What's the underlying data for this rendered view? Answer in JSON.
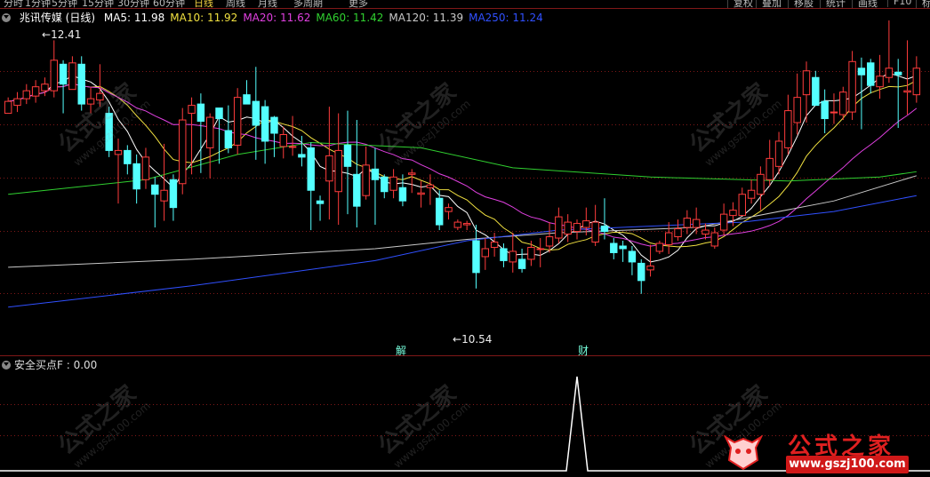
{
  "topbar": {
    "periods": [
      "分时",
      "1分钟",
      "5分钟",
      "15分钟",
      "30分钟",
      "60分钟",
      "日线",
      "周线",
      "月线",
      "多周期",
      "更多"
    ],
    "active_period": "日线",
    "right_buttons": [
      "复权",
      "叠加",
      "移股",
      "统计",
      "画线",
      "F10",
      "标"
    ]
  },
  "main_legend": {
    "stock": "兆讯传媒 (日线)",
    "ma": [
      {
        "label": "MA5: 11.98",
        "color": "#ffffff"
      },
      {
        "label": "MA10: 11.92",
        "color": "#f0e040"
      },
      {
        "label": "MA20: 11.62",
        "color": "#e040e0"
      },
      {
        "label": "MA60: 11.42",
        "color": "#30d030"
      },
      {
        "label": "MA120: 11.39",
        "color": "#c8c8c8"
      },
      {
        "label": "MA250: 11.24",
        "color": "#3050ff"
      }
    ]
  },
  "annotations": {
    "high_label": "12.41",
    "low_label": "10.54",
    "event1": "解",
    "event2": "财"
  },
  "indicator_legend": "安全买点F : 0.00",
  "watermark": {
    "text": "公式之家",
    "url": "www.gszj100.com"
  },
  "logo": {
    "text": "公式之家",
    "url": "www.gszj100.com"
  },
  "colors": {
    "up": "#ff3c3c",
    "down": "#54ffff",
    "grid": "#801818"
  },
  "chart_data": {
    "type": "candlestick",
    "ylim": [
      10.05,
      12.58
    ],
    "candles": [
      [
        11.86,
        11.95,
        11.98,
        11.88
      ],
      [
        11.92,
        11.97,
        12.02,
        11.87
      ],
      [
        11.97,
        12.03,
        12.08,
        11.93
      ],
      [
        11.99,
        12.06,
        12.11,
        11.94
      ],
      [
        12.03,
        12.08,
        12.13,
        11.99
      ],
      [
        12.03,
        12.26,
        12.41,
        11.98
      ],
      [
        12.23,
        12.08,
        12.26,
        11.86
      ],
      [
        12.04,
        12.24,
        12.29,
        12.08
      ],
      [
        12.23,
        11.93,
        12.29,
        11.88
      ],
      [
        11.93,
        11.97,
        12.06,
        11.86
      ],
      [
        11.96,
        12.01,
        12.23,
        11.91
      ],
      [
        11.86,
        11.58,
        11.91,
        11.53
      ],
      [
        11.55,
        11.58,
        11.67,
        11.18
      ],
      [
        11.58,
        11.48,
        11.62,
        11.4
      ],
      [
        11.48,
        11.29,
        11.55,
        11.18
      ],
      [
        11.36,
        11.53,
        11.6,
        11.29
      ],
      [
        11.32,
        11.25,
        11.38,
        11.0
      ],
      [
        11.2,
        11.28,
        11.63,
        11.05
      ],
      [
        11.36,
        11.15,
        11.4,
        11.05
      ],
      [
        11.33,
        11.81,
        11.9,
        11.25
      ],
      [
        11.86,
        11.92,
        11.98,
        11.4
      ],
      [
        11.93,
        11.8,
        12.01,
        11.41
      ],
      [
        11.6,
        11.83,
        11.86,
        11.37
      ],
      [
        11.9,
        11.82,
        11.86,
        11.48
      ],
      [
        11.73,
        11.6,
        11.92,
        11.56
      ],
      [
        11.62,
        11.98,
        12.05,
        11.55
      ],
      [
        12.0,
        11.93,
        12.11,
        11.95
      ],
      [
        11.95,
        11.77,
        12.21,
        11.51
      ],
      [
        11.91,
        11.65,
        11.96,
        11.48
      ],
      [
        11.83,
        11.71,
        11.84,
        11.53
      ],
      [
        11.61,
        11.7,
        11.76,
        11.52
      ],
      [
        11.61,
        11.61,
        11.84,
        11.54
      ],
      [
        11.55,
        11.53,
        11.69,
        11.46
      ],
      [
        11.6,
        11.28,
        11.64,
        10.98
      ],
      [
        11.2,
        11.18,
        11.24,
        11.05
      ],
      [
        11.35,
        11.54,
        11.91,
        11.06
      ],
      [
        11.27,
        11.58,
        11.86,
        11.02
      ],
      [
        11.62,
        11.46,
        11.88,
        11.1
      ],
      [
        11.4,
        11.16,
        11.81,
        11.0
      ],
      [
        11.24,
        11.47,
        11.61,
        11.21
      ],
      [
        11.44,
        11.36,
        11.6,
        11.02
      ],
      [
        11.38,
        11.27,
        11.4,
        11.22
      ],
      [
        11.28,
        11.38,
        11.44,
        11.22
      ],
      [
        11.3,
        11.2,
        11.4,
        11.16
      ],
      [
        11.4,
        11.41,
        11.44,
        11.26
      ],
      [
        11.25,
        11.26,
        11.35,
        11.15
      ],
      [
        11.3,
        11.32,
        11.4,
        11.17
      ],
      [
        11.22,
        11.02,
        11.28,
        10.98
      ],
      [
        11.12,
        11.15,
        11.18,
        11.06
      ],
      [
        11.0,
        11.04,
        11.06,
        10.98
      ],
      [
        11.02,
        11.03,
        11.05,
        10.98
      ],
      [
        10.9,
        10.66,
        11.02,
        10.54
      ],
      [
        10.78,
        10.84,
        10.92,
        10.68
      ],
      [
        10.85,
        10.89,
        10.96,
        10.78
      ],
      [
        10.84,
        10.75,
        10.88,
        10.7
      ],
      [
        10.74,
        10.82,
        10.96,
        10.66
      ],
      [
        10.76,
        10.69,
        10.84,
        10.66
      ],
      [
        10.76,
        10.85,
        10.9,
        10.71
      ],
      [
        10.84,
        10.84,
        10.92,
        10.7
      ],
      [
        10.86,
        10.93,
        11.04,
        10.81
      ],
      [
        10.92,
        11.08,
        11.15,
        10.88
      ],
      [
        10.95,
        11.04,
        11.1,
        10.89
      ],
      [
        10.97,
        11.03,
        11.06,
        10.91
      ],
      [
        11.0,
        11.05,
        11.15,
        10.94
      ],
      [
        10.89,
        11.04,
        11.17,
        10.86
      ],
      [
        11.01,
        10.97,
        11.22,
        10.91
      ],
      [
        10.88,
        10.81,
        10.92,
        10.76
      ],
      [
        10.86,
        10.84,
        10.9,
        10.74
      ],
      [
        10.82,
        10.74,
        10.86,
        10.64
      ],
      [
        10.73,
        10.6,
        10.76,
        10.5
      ],
      [
        10.68,
        10.71,
        10.87,
        10.63
      ],
      [
        10.82,
        10.88,
        10.9,
        10.8
      ],
      [
        10.87,
        10.96,
        11.04,
        10.8
      ],
      [
        10.93,
        10.99,
        11.06,
        10.9
      ],
      [
        11.0,
        11.07,
        11.13,
        10.95
      ],
      [
        11.0,
        11.06,
        11.15,
        10.95
      ],
      [
        10.95,
        10.98,
        11.03,
        10.91
      ],
      [
        10.86,
        10.96,
        11.0,
        10.84
      ],
      [
        10.98,
        11.1,
        11.18,
        10.94
      ],
      [
        11.09,
        11.13,
        11.19,
        11.01
      ],
      [
        11.09,
        11.25,
        11.3,
        11.12
      ],
      [
        11.22,
        11.28,
        11.36,
        11.18
      ],
      [
        11.25,
        11.4,
        11.46,
        11.13
      ],
      [
        11.36,
        11.52,
        11.66,
        11.31
      ],
      [
        11.46,
        11.65,
        11.72,
        11.4
      ],
      [
        11.6,
        11.88,
        12.0,
        11.55
      ],
      [
        11.79,
        11.98,
        12.16,
        11.7
      ],
      [
        12.0,
        12.18,
        12.25,
        11.79
      ],
      [
        12.13,
        11.92,
        12.18,
        11.96
      ],
      [
        11.95,
        11.82,
        12.04,
        11.71
      ],
      [
        11.87,
        11.87,
        12.01,
        11.78
      ],
      [
        11.85,
        12.02,
        12.06,
        11.81
      ],
      [
        11.87,
        12.25,
        12.33,
        11.81
      ],
      [
        12.2,
        12.15,
        12.28,
        11.74
      ],
      [
        12.24,
        12.07,
        12.27,
        12.01
      ],
      [
        12.06,
        12.14,
        12.3,
        11.97
      ],
      [
        12.13,
        12.2,
        12.56,
        12.09
      ],
      [
        12.17,
        12.15,
        12.27,
        11.75
      ],
      [
        12.02,
        12.03,
        12.41,
        11.85
      ],
      [
        12.0,
        12.2,
        12.29,
        11.94
      ]
    ],
    "indicator": {
      "name": "安全买点F",
      "value": 0.0,
      "spike_index": 62,
      "spike_value": 1
    }
  }
}
